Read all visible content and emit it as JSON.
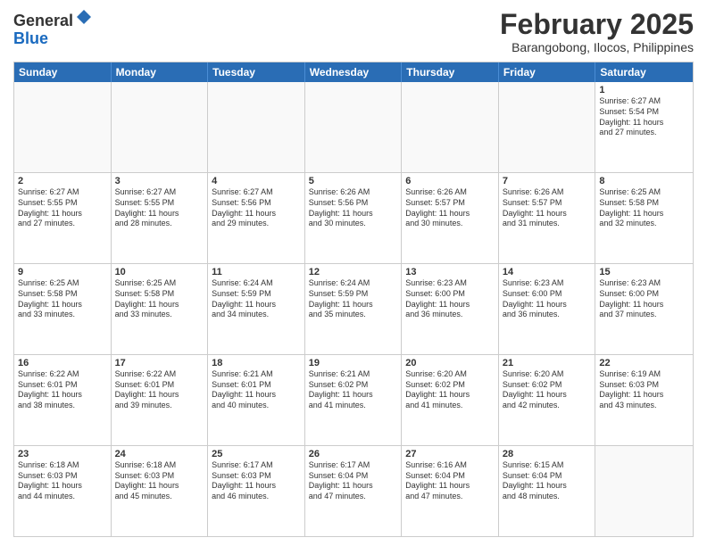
{
  "logo": {
    "general": "General",
    "blue": "Blue"
  },
  "title": "February 2025",
  "location": "Barangobong, Ilocos, Philippines",
  "days": [
    "Sunday",
    "Monday",
    "Tuesday",
    "Wednesday",
    "Thursday",
    "Friday",
    "Saturday"
  ],
  "weeks": [
    [
      {
        "day": "",
        "text": ""
      },
      {
        "day": "",
        "text": ""
      },
      {
        "day": "",
        "text": ""
      },
      {
        "day": "",
        "text": ""
      },
      {
        "day": "",
        "text": ""
      },
      {
        "day": "",
        "text": ""
      },
      {
        "day": "1",
        "text": "Sunrise: 6:27 AM\nSunset: 5:54 PM\nDaylight: 11 hours\nand 27 minutes."
      }
    ],
    [
      {
        "day": "2",
        "text": "Sunrise: 6:27 AM\nSunset: 5:55 PM\nDaylight: 11 hours\nand 27 minutes."
      },
      {
        "day": "3",
        "text": "Sunrise: 6:27 AM\nSunset: 5:55 PM\nDaylight: 11 hours\nand 28 minutes."
      },
      {
        "day": "4",
        "text": "Sunrise: 6:27 AM\nSunset: 5:56 PM\nDaylight: 11 hours\nand 29 minutes."
      },
      {
        "day": "5",
        "text": "Sunrise: 6:26 AM\nSunset: 5:56 PM\nDaylight: 11 hours\nand 30 minutes."
      },
      {
        "day": "6",
        "text": "Sunrise: 6:26 AM\nSunset: 5:57 PM\nDaylight: 11 hours\nand 30 minutes."
      },
      {
        "day": "7",
        "text": "Sunrise: 6:26 AM\nSunset: 5:57 PM\nDaylight: 11 hours\nand 31 minutes."
      },
      {
        "day": "8",
        "text": "Sunrise: 6:25 AM\nSunset: 5:58 PM\nDaylight: 11 hours\nand 32 minutes."
      }
    ],
    [
      {
        "day": "9",
        "text": "Sunrise: 6:25 AM\nSunset: 5:58 PM\nDaylight: 11 hours\nand 33 minutes."
      },
      {
        "day": "10",
        "text": "Sunrise: 6:25 AM\nSunset: 5:58 PM\nDaylight: 11 hours\nand 33 minutes."
      },
      {
        "day": "11",
        "text": "Sunrise: 6:24 AM\nSunset: 5:59 PM\nDaylight: 11 hours\nand 34 minutes."
      },
      {
        "day": "12",
        "text": "Sunrise: 6:24 AM\nSunset: 5:59 PM\nDaylight: 11 hours\nand 35 minutes."
      },
      {
        "day": "13",
        "text": "Sunrise: 6:23 AM\nSunset: 6:00 PM\nDaylight: 11 hours\nand 36 minutes."
      },
      {
        "day": "14",
        "text": "Sunrise: 6:23 AM\nSunset: 6:00 PM\nDaylight: 11 hours\nand 36 minutes."
      },
      {
        "day": "15",
        "text": "Sunrise: 6:23 AM\nSunset: 6:00 PM\nDaylight: 11 hours\nand 37 minutes."
      }
    ],
    [
      {
        "day": "16",
        "text": "Sunrise: 6:22 AM\nSunset: 6:01 PM\nDaylight: 11 hours\nand 38 minutes."
      },
      {
        "day": "17",
        "text": "Sunrise: 6:22 AM\nSunset: 6:01 PM\nDaylight: 11 hours\nand 39 minutes."
      },
      {
        "day": "18",
        "text": "Sunrise: 6:21 AM\nSunset: 6:01 PM\nDaylight: 11 hours\nand 40 minutes."
      },
      {
        "day": "19",
        "text": "Sunrise: 6:21 AM\nSunset: 6:02 PM\nDaylight: 11 hours\nand 41 minutes."
      },
      {
        "day": "20",
        "text": "Sunrise: 6:20 AM\nSunset: 6:02 PM\nDaylight: 11 hours\nand 41 minutes."
      },
      {
        "day": "21",
        "text": "Sunrise: 6:20 AM\nSunset: 6:02 PM\nDaylight: 11 hours\nand 42 minutes."
      },
      {
        "day": "22",
        "text": "Sunrise: 6:19 AM\nSunset: 6:03 PM\nDaylight: 11 hours\nand 43 minutes."
      }
    ],
    [
      {
        "day": "23",
        "text": "Sunrise: 6:18 AM\nSunset: 6:03 PM\nDaylight: 11 hours\nand 44 minutes."
      },
      {
        "day": "24",
        "text": "Sunrise: 6:18 AM\nSunset: 6:03 PM\nDaylight: 11 hours\nand 45 minutes."
      },
      {
        "day": "25",
        "text": "Sunrise: 6:17 AM\nSunset: 6:03 PM\nDaylight: 11 hours\nand 46 minutes."
      },
      {
        "day": "26",
        "text": "Sunrise: 6:17 AM\nSunset: 6:04 PM\nDaylight: 11 hours\nand 47 minutes."
      },
      {
        "day": "27",
        "text": "Sunrise: 6:16 AM\nSunset: 6:04 PM\nDaylight: 11 hours\nand 47 minutes."
      },
      {
        "day": "28",
        "text": "Sunrise: 6:15 AM\nSunset: 6:04 PM\nDaylight: 11 hours\nand 48 minutes."
      },
      {
        "day": "",
        "text": ""
      }
    ]
  ]
}
